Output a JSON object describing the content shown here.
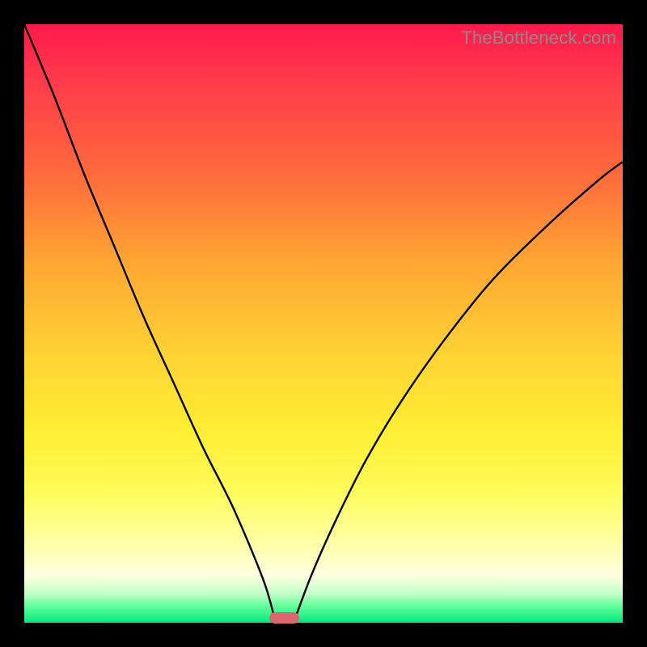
{
  "watermark": "TheBottleneck.com",
  "chart_data": {
    "type": "line",
    "title": "",
    "xlabel": "",
    "ylabel": "",
    "xlim": [
      0,
      100
    ],
    "ylim": [
      0,
      100
    ],
    "grid": false,
    "legend": false,
    "series": [
      {
        "name": "left-curve",
        "x": [
          0,
          5,
          10,
          15,
          20,
          25,
          30,
          35,
          40,
          42
        ],
        "values": [
          100,
          88,
          75,
          63,
          51,
          40,
          29,
          19,
          7,
          0
        ]
      },
      {
        "name": "right-curve",
        "x": [
          45,
          48,
          52,
          57,
          63,
          70,
          78,
          87,
          96,
          100
        ],
        "values": [
          0,
          8,
          17,
          27,
          37,
          47,
          57,
          66,
          74,
          77
        ]
      }
    ],
    "marker": {
      "x_center": 43.5,
      "width": 5,
      "color": "#d9676b"
    },
    "background_gradient": {
      "top": "#ff1a4d",
      "middle": "#ffee33",
      "bottom": "#00e87a"
    },
    "curve_color": "#000000"
  }
}
